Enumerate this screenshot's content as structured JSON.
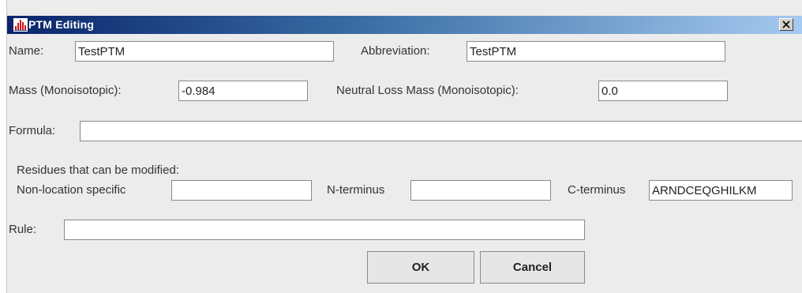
{
  "window": {
    "title": "PTM Editing",
    "icon": "bar-chart-icon",
    "close_glyph": "×",
    "accent_color": "#0a246a"
  },
  "form": {
    "name": {
      "label": "Name:",
      "value": "TestPTM"
    },
    "abbreviation": {
      "label": "Abbreviation:",
      "value": "TestPTM"
    },
    "mass": {
      "label": "Mass (Monoisotopic):",
      "value": "-0.984"
    },
    "neutral_loss": {
      "label": "Neutral Loss Mass (Monoisotopic):",
      "value": "0.0"
    },
    "formula": {
      "label": "Formula:",
      "value": ""
    },
    "residues": {
      "heading": "Residues that can be modified:",
      "non_location": {
        "label": "Non-location specific",
        "value": ""
      },
      "n_terminus": {
        "label": "N-terminus",
        "value": ""
      },
      "c_terminus": {
        "label": "C-terminus",
        "value": "ARNDCEQGHILKM"
      }
    },
    "rule": {
      "label": "Rule:",
      "value": ""
    }
  },
  "buttons": {
    "ok": "OK",
    "cancel": "Cancel"
  }
}
